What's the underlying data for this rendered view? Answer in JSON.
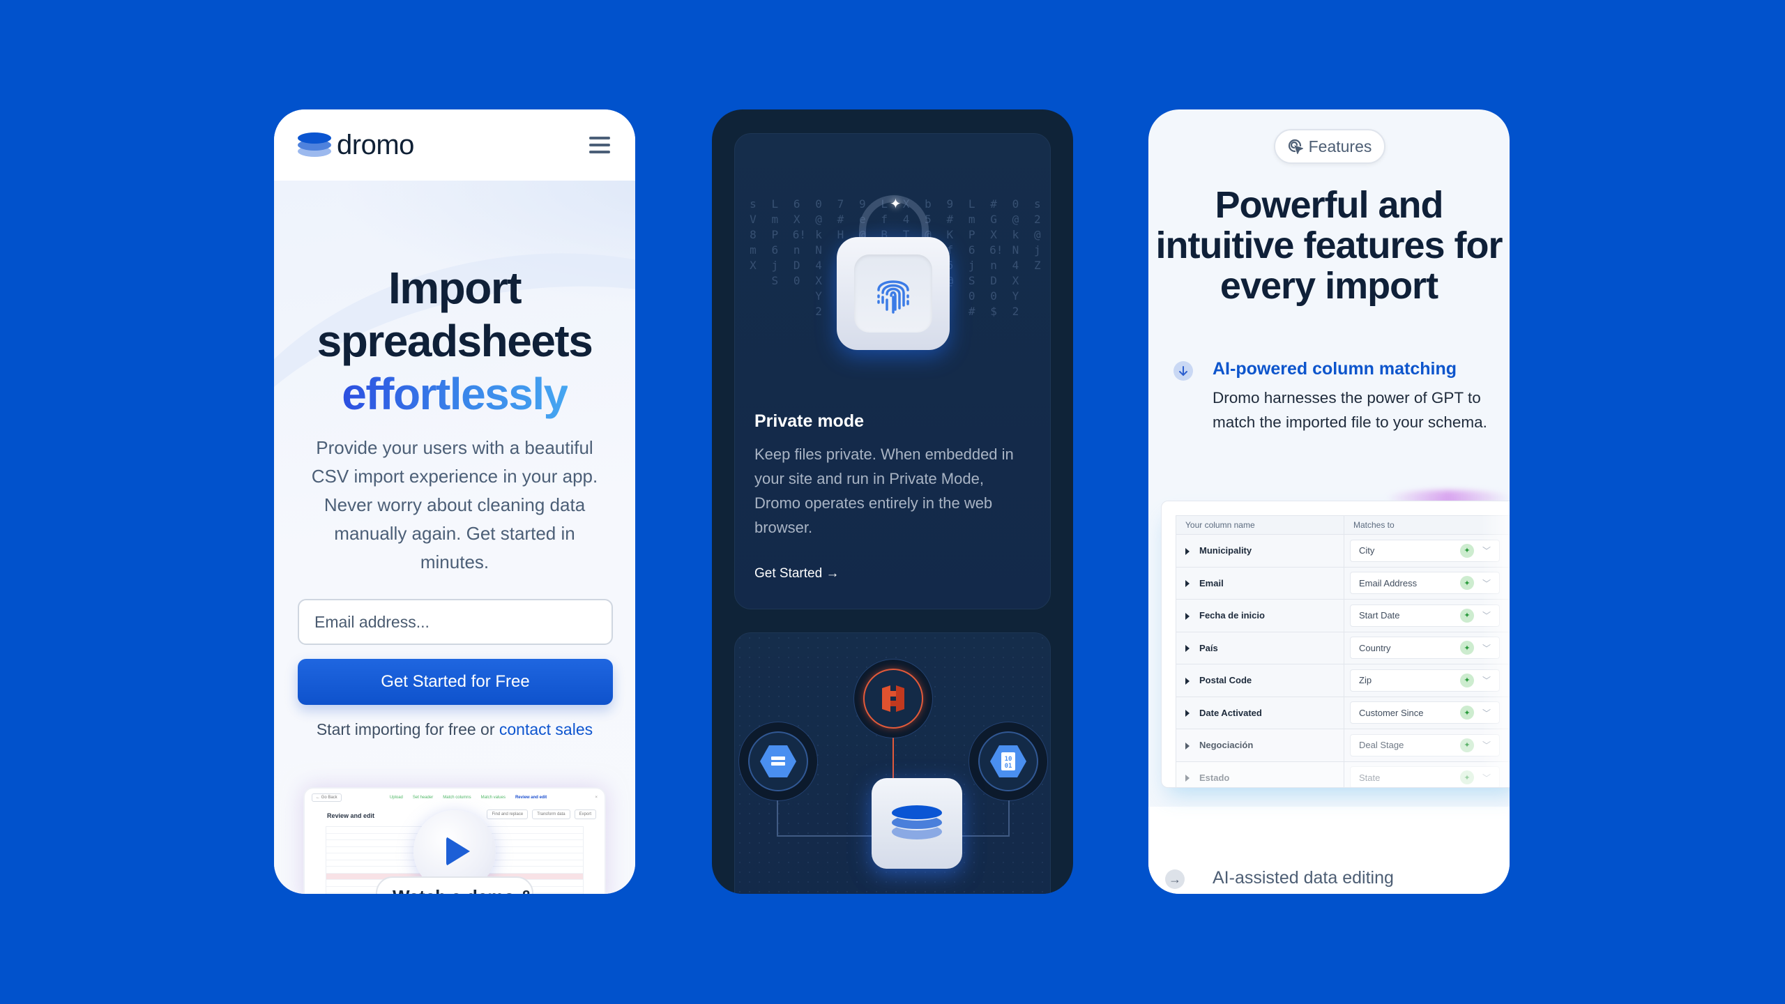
{
  "background_color": "#0152cc",
  "card_hero": {
    "brand": "dromo",
    "menu_icon": "hamburger-menu-icon",
    "title_line1": "Import",
    "title_line2": "spreadsheets",
    "title_accent": "effortlessly",
    "subtitle": "Provide your users with a beautiful CSV import experience in your app. Never worry about cleaning data manually again. Get started in minutes.",
    "email_placeholder": "Email address...",
    "cta_label": "Get Started for Free",
    "note_prefix": "Start importing for free or ",
    "note_link": "contact sales",
    "video": {
      "back_label": "← Go Back",
      "steps": [
        "Upload",
        "Set header",
        "Match columns",
        "Match values",
        "Review and edit"
      ],
      "title": "Review and edit",
      "tools": [
        "Find and replace",
        "Transform data",
        "Export"
      ],
      "watch_label": "Watch a demo & ...",
      "play_icon": "play-icon"
    },
    "accent_color": "#0e55cf"
  },
  "card_private": {
    "title": "Private mode",
    "body": "Keep files private. When embedded in your site and run in Private Mode, Dromo operates entirely in the web browser.",
    "link_label": "Get Started →",
    "code_rain": [
      "s V 8 m X",
      "L m P 6 j S",
      "6 X 6 ! n D 0",
      "0 @ k N 4 X Y 2",
      "7 # H g Z a",
      "9 e @ 2 A X P",
      "L f B 1 5",
      "X 4 T 3 7 c",
      "b 5 @ 5 V",
      "9 # K f 6 @",
      "L m P 6 j S 0 #",
      "# G X 6 ! n D 0 $",
      "0 @ k N 4 X Y 2",
      "s 2 @ j Z"
    ],
    "integrations": [
      {
        "name": "Amazon S3",
        "icon": "aws-s3-icon",
        "color": "#e0522f"
      },
      {
        "name": "Google Cloud Storage",
        "icon": "google-cloud-storage-icon",
        "color": "#4a8ff0"
      },
      {
        "name": "Google BigQuery",
        "icon": "bigquery-file-icon",
        "color": "#4a8ff0"
      }
    ]
  },
  "card_features": {
    "pill_label": "Features",
    "title": "Powerful and intuitive features for every import",
    "feature1_title": "AI-powered column matching",
    "feature1_desc": "Dromo harnesses the power of GPT to match the imported file to your schema.",
    "feature2_title": "AI-assisted data editing",
    "table": {
      "headers": [
        "Your column name",
        "Matches to"
      ],
      "rows": [
        {
          "source": "Municipality",
          "target": "City"
        },
        {
          "source": "Email",
          "target": "Email Address"
        },
        {
          "source": "Fecha de inicio",
          "target": "Start Date"
        },
        {
          "source": "País",
          "target": "Country"
        },
        {
          "source": "Postal Code",
          "target": "Zip"
        },
        {
          "source": "Date Activated",
          "target": "Customer Since"
        },
        {
          "source": "Negociación",
          "target": "Deal Stage"
        },
        {
          "source": "Estado",
          "target": "State"
        }
      ]
    },
    "accent_color": "#0d55cc"
  }
}
